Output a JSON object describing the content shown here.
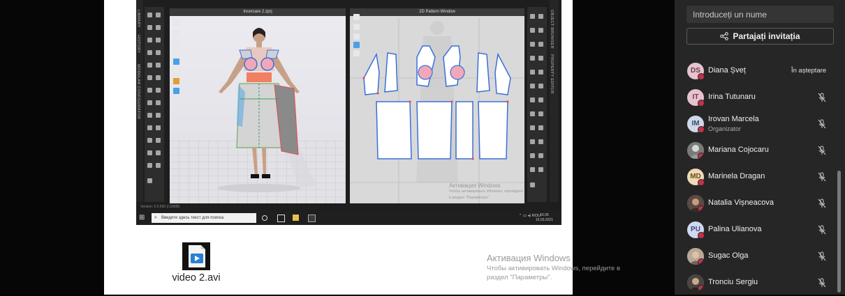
{
  "slide": {
    "app_screenshot": {
      "left_strip_labels": [
        "LIBRARY",
        "HISTORY",
        "MODULAR CONFIGURATOR"
      ],
      "right_strip_labels": [
        "OBJECT BROWSER",
        "PROPERTY EDITOR"
      ],
      "window_3d_title": "Incercare 2.zprj",
      "window_2d_title": "2D Pattern Window",
      "activation_ghost_title": "Активация Windows",
      "activation_ghost_text": "Чтобы активировать Windows, перейдите в раздел \"Параметры\".",
      "version_text": "Version: 6.0.560 (r12888)",
      "taskbar": {
        "search_placeholder": "Введите здесь текст для поиска",
        "tray_lang": "ROU",
        "clock_time": "16:36",
        "clock_date": "15.03.2021"
      }
    },
    "file": {
      "label": "video 2.avi",
      "icon": "video-file-icon"
    }
  },
  "windows_activation": {
    "title": "Активация Windows",
    "line1": "Чтобы активировать Windows, перейдите в",
    "line2": "раздел \"Параметры\"."
  },
  "panel": {
    "name_input_placeholder": "Introduceți un nume",
    "invite_label": "Partajați invitația",
    "invite_icon": "share-icon",
    "participants": [
      {
        "initials": "DS",
        "name": "Diana Șveț",
        "status": "În așteptare",
        "avatar_color": "#e6c3ce"
      },
      {
        "initials": "IT",
        "name": "Irina Tutunaru",
        "mic": "mic-off-icon",
        "avatar_color": "#e6c3ce"
      },
      {
        "initials": "IM",
        "name": "Irovan Marcela",
        "role": "Organizator",
        "mic": "mic-off-icon",
        "avatar_color": "#cfd8e8"
      },
      {
        "initials": "",
        "name": "Mariana Cojocaru",
        "mic": "mic-off-icon",
        "photo": true
      },
      {
        "initials": "MD",
        "name": "Marinela Dragan",
        "mic": "mic-off-icon",
        "avatar_color": "#f0d9b5"
      },
      {
        "initials": "",
        "name": "Natalia Vișneacova",
        "mic": "mic-off-icon",
        "photo": true
      },
      {
        "initials": "PU",
        "name": "Palina Ulianova",
        "mic": "mic-off-icon",
        "avatar_color": "#cfd8f0"
      },
      {
        "initials": "",
        "name": "Sugac Olga",
        "mic": "mic-off-icon",
        "photo": true
      },
      {
        "initials": "",
        "name": "Tronciu Sergiu",
        "mic": "mic-off-icon",
        "photo": true
      }
    ]
  },
  "colors": {
    "panel_bg": "#262626",
    "muted_dot": "#c4314b",
    "pattern_outline": "#3a6fd8"
  }
}
